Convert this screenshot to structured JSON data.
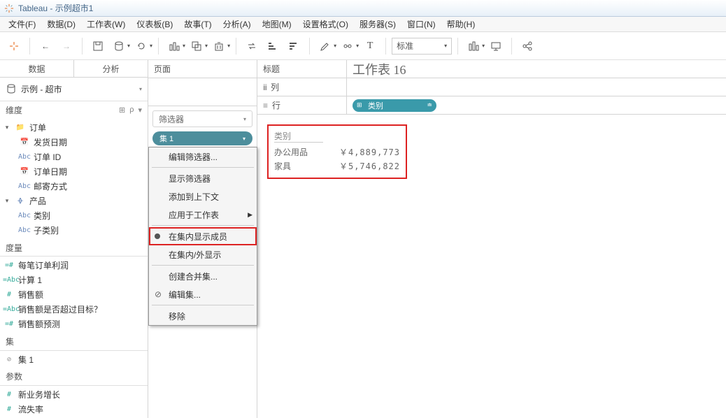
{
  "titlebar": {
    "app": "Tableau",
    "doc": "示例超市1"
  },
  "menu": [
    "文件(F)",
    "数据(D)",
    "工作表(W)",
    "仪表板(B)",
    "故事(T)",
    "分析(A)",
    "地图(M)",
    "设置格式(O)",
    "服务器(S)",
    "窗口(N)",
    "帮助(H)"
  ],
  "toolbar": {
    "standard_combo": "标准"
  },
  "sidepanel": {
    "tab_data": "数据",
    "tab_analysis": "分析",
    "datasource": "示例 - 超市",
    "sec_dim": "维度",
    "sec_meas": "度量",
    "sec_set": "集",
    "sec_param": "参数",
    "dims": {
      "order_folder": "订单",
      "ship_date": "发货日期",
      "order_id": "订单 ID",
      "order_date": "订单日期",
      "ship_mode": "邮寄方式",
      "product_folder": "产品",
      "category": "类别",
      "subcategory": "子类别"
    },
    "meas": {
      "profit_per_order": "每笔订单利润",
      "calc1": "计算 1",
      "sales": "销售额",
      "sales_flag": "销售额是否超过目标？",
      "sales_forecast": "销售额预测"
    },
    "sets": {
      "set1": "集 1"
    },
    "params": {
      "new_growth": "新业务增长",
      "trunc": "流失率"
    }
  },
  "shelves": {
    "pages": "页面",
    "filters": "筛选器",
    "filter_pill": "集 1",
    "title_label": "标题",
    "worksheet_title": "工作表 16",
    "columns_label": "列",
    "rows_label": "行",
    "row_pill": "类别"
  },
  "context_menu": {
    "edit_filter": "编辑筛选器...",
    "show_filter": "显示筛选器",
    "add_to_context": "添加到上下文",
    "apply_to_ws": "应用于工作表",
    "show_in_set": "在集内显示成员",
    "show_in_out": "在集内/外显示",
    "create_combined": "创建合并集...",
    "edit_set": "编辑集...",
    "remove": "移除"
  },
  "viz": {
    "header": "类别",
    "rows": [
      {
        "cat": "办公用品",
        "val": "￥4,889,773"
      },
      {
        "cat": "家具",
        "val": "￥5,746,822"
      }
    ]
  }
}
